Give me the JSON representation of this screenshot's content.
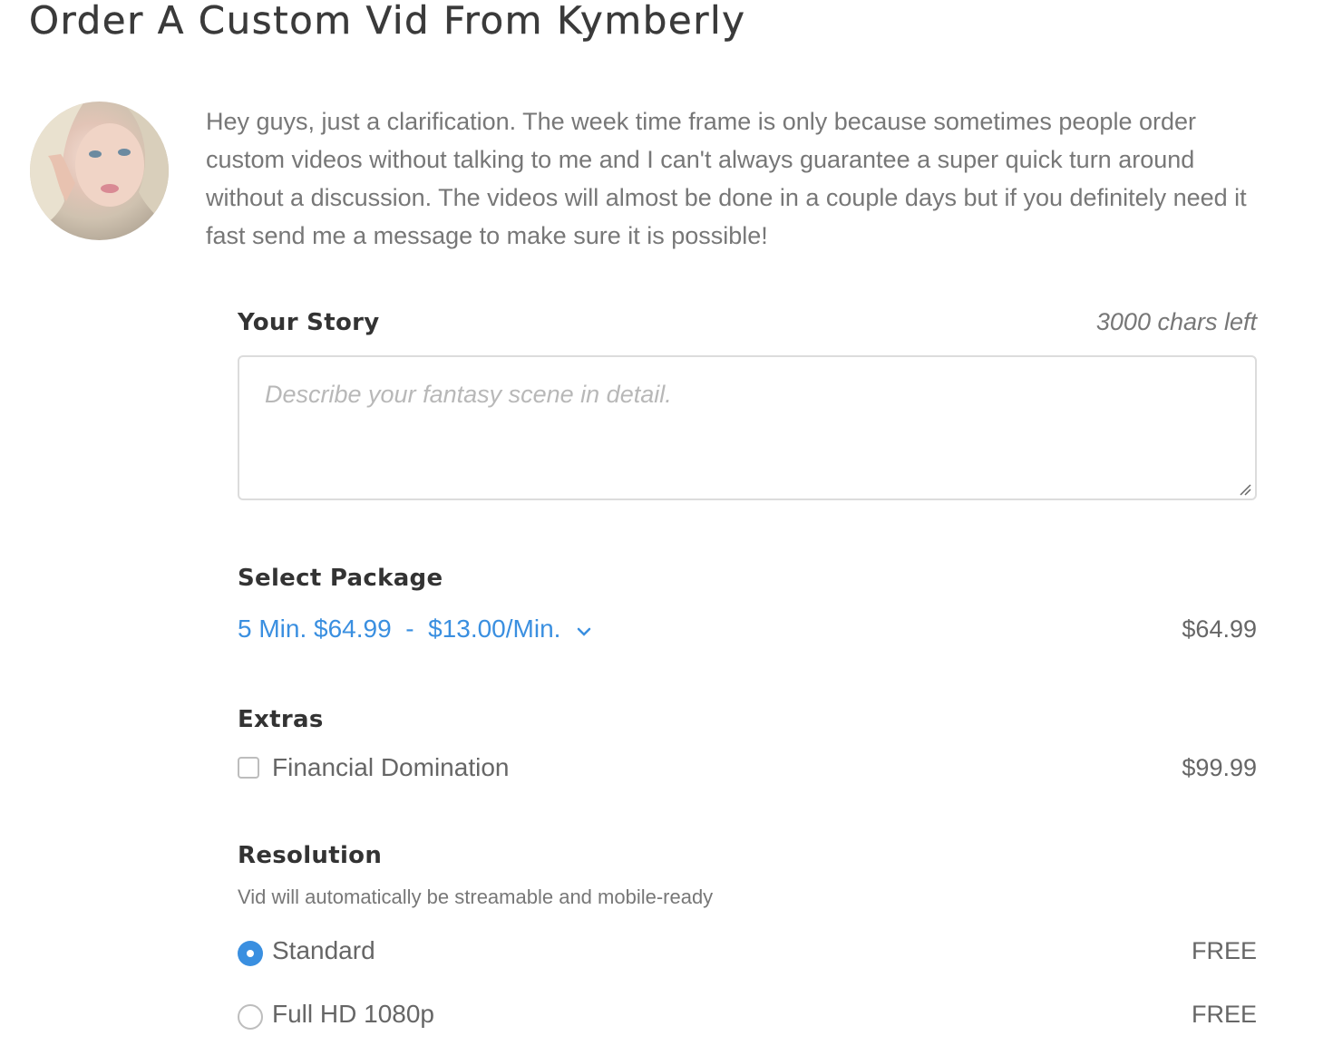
{
  "page": {
    "title": "Order A Custom Vid From Kymberly"
  },
  "intro_text": "Hey guys, just a clarification.  The week time frame is only because sometimes people order custom videos without talking to me and I can't always guarantee a super quick turn around without a discussion.  The videos will almost be done in a couple days but if you definitely need it fast send me a message to make sure it is possible!",
  "story": {
    "heading": "Your Story",
    "chars_left": "3000 chars left",
    "placeholder": "Describe your fantasy scene in detail.",
    "value": ""
  },
  "package": {
    "heading": "Select Package",
    "selected": "5 Min. $64.99  -  $13.00/Min.",
    "price": "$64.99"
  },
  "extras": {
    "heading": "Extras",
    "items": [
      {
        "label": "Financial Domination",
        "price": "$99.99",
        "checked": false
      }
    ]
  },
  "resolution": {
    "heading": "Resolution",
    "note": "Vid will automatically be streamable and mobile-ready",
    "options": [
      {
        "label": "Standard",
        "price": "FREE",
        "selected": true
      },
      {
        "label": "Full HD 1080p",
        "price": "FREE",
        "selected": false
      }
    ]
  },
  "colors": {
    "accent": "#3a8fe0",
    "heading": "#333333",
    "body_text": "#777777"
  }
}
